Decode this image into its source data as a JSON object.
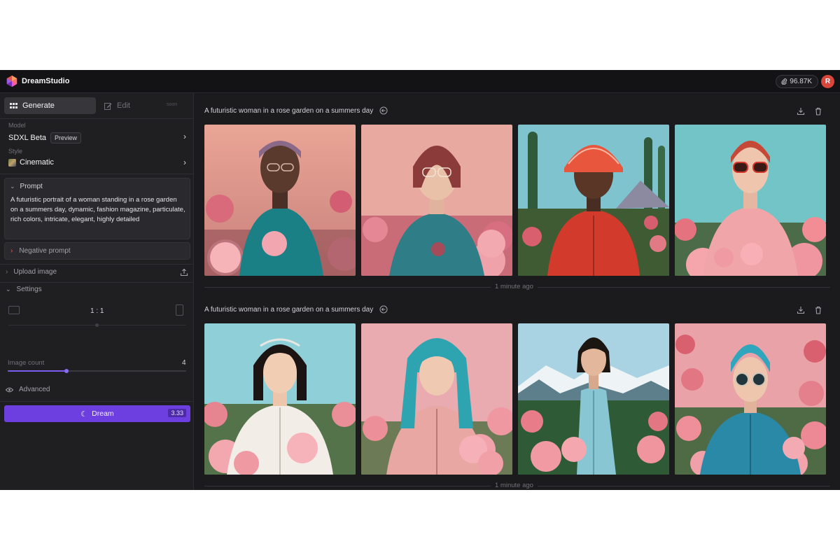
{
  "app": {
    "title": "DreamStudio",
    "credits": "96.87K",
    "avatar_initial": "R"
  },
  "tabs": {
    "generate": "Generate",
    "edit": "Edit",
    "soon": "soon"
  },
  "model": {
    "label": "Model",
    "name": "SDXL Beta",
    "badge": "Preview"
  },
  "style": {
    "label": "Style",
    "name": "Cinematic"
  },
  "prompt": {
    "label": "Prompt",
    "text": "A futuristic portrait of a woman standing in a rose garden on a summers day, dynamic, fashion magazine, particulate, rich colors, intricate, elegant, highly detailed"
  },
  "negative_prompt": {
    "label": "Negative prompt"
  },
  "upload": {
    "label": "Upload image"
  },
  "settings": {
    "label": "Settings",
    "aspect_ratio": "1 : 1",
    "image_count_label": "Image count",
    "image_count": "4",
    "image_count_fraction": 0.33,
    "advanced_label": "Advanced"
  },
  "dream": {
    "label": "Dream",
    "cost": "3.33"
  },
  "generations": [
    {
      "prompt": "A futuristic woman in a rose garden on a summers day",
      "time": "1 minute ago"
    },
    {
      "prompt": "A futuristic woman in a rose garden on a summers day",
      "time": "1 minute ago"
    }
  ],
  "colors": {
    "accent": "#6d3fe0",
    "avatar": "#d9463b",
    "sidebar_bg": "#1f1f22",
    "main_bg": "#1b1b1e"
  }
}
